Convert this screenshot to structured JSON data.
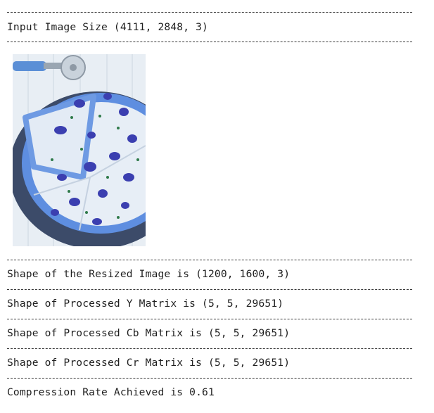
{
  "output_lines": {
    "input_size": "Input Image Size (4111, 2848, 3)",
    "resized_shape": "Shape of the Resized Image is (1200, 1600, 3)",
    "y_shape": "Shape of Processed Y Matrix is (5, 5, 29651)",
    "cb_shape": "Shape of Processed Cb Matrix is (5, 5, 29651)",
    "cr_shape": "Shape of Processed Cr Matrix is (5, 5, 29651)",
    "compression_rate": "Compression Rate Achieved is 0.61"
  },
  "image": {
    "subject": "pizza-photo",
    "colors": {
      "crust": "#5f8fe0",
      "cheese": "#e9f0f6",
      "topping": "#3b3fb0",
      "board": "#3b4a6a",
      "wood": "#e7edf3"
    }
  }
}
